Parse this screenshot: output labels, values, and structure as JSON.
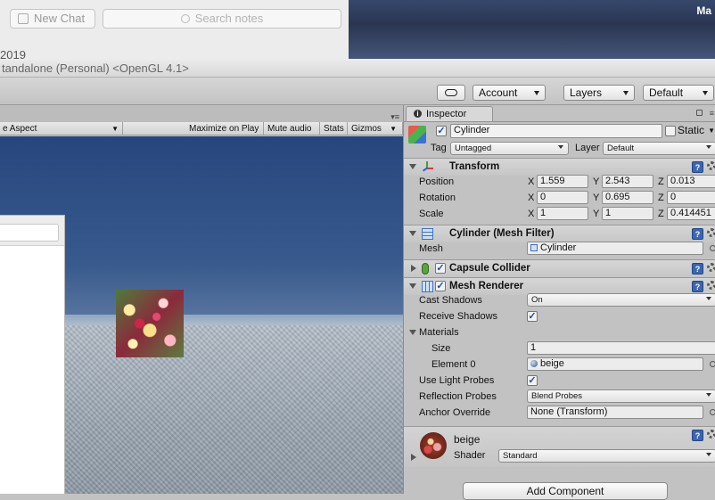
{
  "notes_app": {
    "new_chat_label": "New Chat",
    "search_placeholder": "Search notes",
    "fragment": "2019"
  },
  "desktop": {
    "corner_text": "Ma"
  },
  "window": {
    "title": "tandalone (Personal) <OpenGL 4.1>"
  },
  "toolbar": {
    "account": "Account",
    "layers": "Layers",
    "layout": "Default"
  },
  "game_view": {
    "aspect": "e Aspect",
    "maximize_on_play": "Maximize on Play",
    "mute_audio": "Mute audio",
    "stats": "Stats",
    "gizmos": "Gizmos"
  },
  "inspector": {
    "tab_label": "Inspector",
    "object_name": "Cylinder",
    "static_label": "Static",
    "tag_label": "Tag",
    "tag_value": "Untagged",
    "layer_label": "Layer",
    "layer_value": "Default",
    "transform": {
      "title": "Transform",
      "position_label": "Position",
      "rotation_label": "Rotation",
      "scale_label": "Scale",
      "position": {
        "x": "1.559",
        "y": "2.543",
        "z": "0.013"
      },
      "rotation": {
        "x": "0",
        "y": "0.695",
        "z": "0"
      },
      "scale": {
        "x": "1",
        "y": "1",
        "z": "0.414451"
      }
    },
    "mesh_filter": {
      "title": "Cylinder (Mesh Filter)",
      "mesh_label": "Mesh",
      "mesh_value": "Cylinder"
    },
    "capsule_collider": {
      "title": "Capsule Collider"
    },
    "mesh_renderer": {
      "title": "Mesh Renderer",
      "cast_shadows_label": "Cast Shadows",
      "cast_shadows_value": "On",
      "receive_shadows_label": "Receive Shadows",
      "materials_label": "Materials",
      "size_label": "Size",
      "size_value": "1",
      "element0_label": "Element 0",
      "element0_value": "beige",
      "light_probes_label": "Use Light Probes",
      "reflection_probes_label": "Reflection Probes",
      "reflection_probes_value": "Blend Probes",
      "anchor_override_label": "Anchor Override",
      "anchor_override_value": "None (Transform)"
    },
    "material": {
      "name": "beige",
      "shader_label": "Shader",
      "shader_value": "Standard"
    },
    "add_component": "Add Component",
    "axis_x": "X",
    "axis_y": "Y",
    "axis_z": "Z"
  },
  "colors": {
    "sky": "#2c4a80",
    "help_icon": "#3b66b3"
  }
}
